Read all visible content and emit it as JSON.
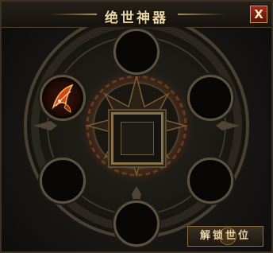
{
  "window": {
    "title": "绝世神器",
    "close_label": "X"
  },
  "slots": [
    {
      "id": "top",
      "filled": false
    },
    {
      "id": "upper-right",
      "filled": false
    },
    {
      "id": "lower-right",
      "filled": false
    },
    {
      "id": "bottom",
      "filled": false
    },
    {
      "id": "lower-left",
      "filled": false
    },
    {
      "id": "upper-left",
      "filled": true,
      "icon": "artifact-claw-icon"
    }
  ],
  "center": {
    "icon": "empty-socket-icon"
  },
  "actions": {
    "unlock_label": "解锁世位"
  },
  "colors": {
    "title_text": "#e8d3a2",
    "frame_gold": "#b08c50",
    "glow_orange": "#d2541c",
    "close_red": "#a1291b"
  }
}
